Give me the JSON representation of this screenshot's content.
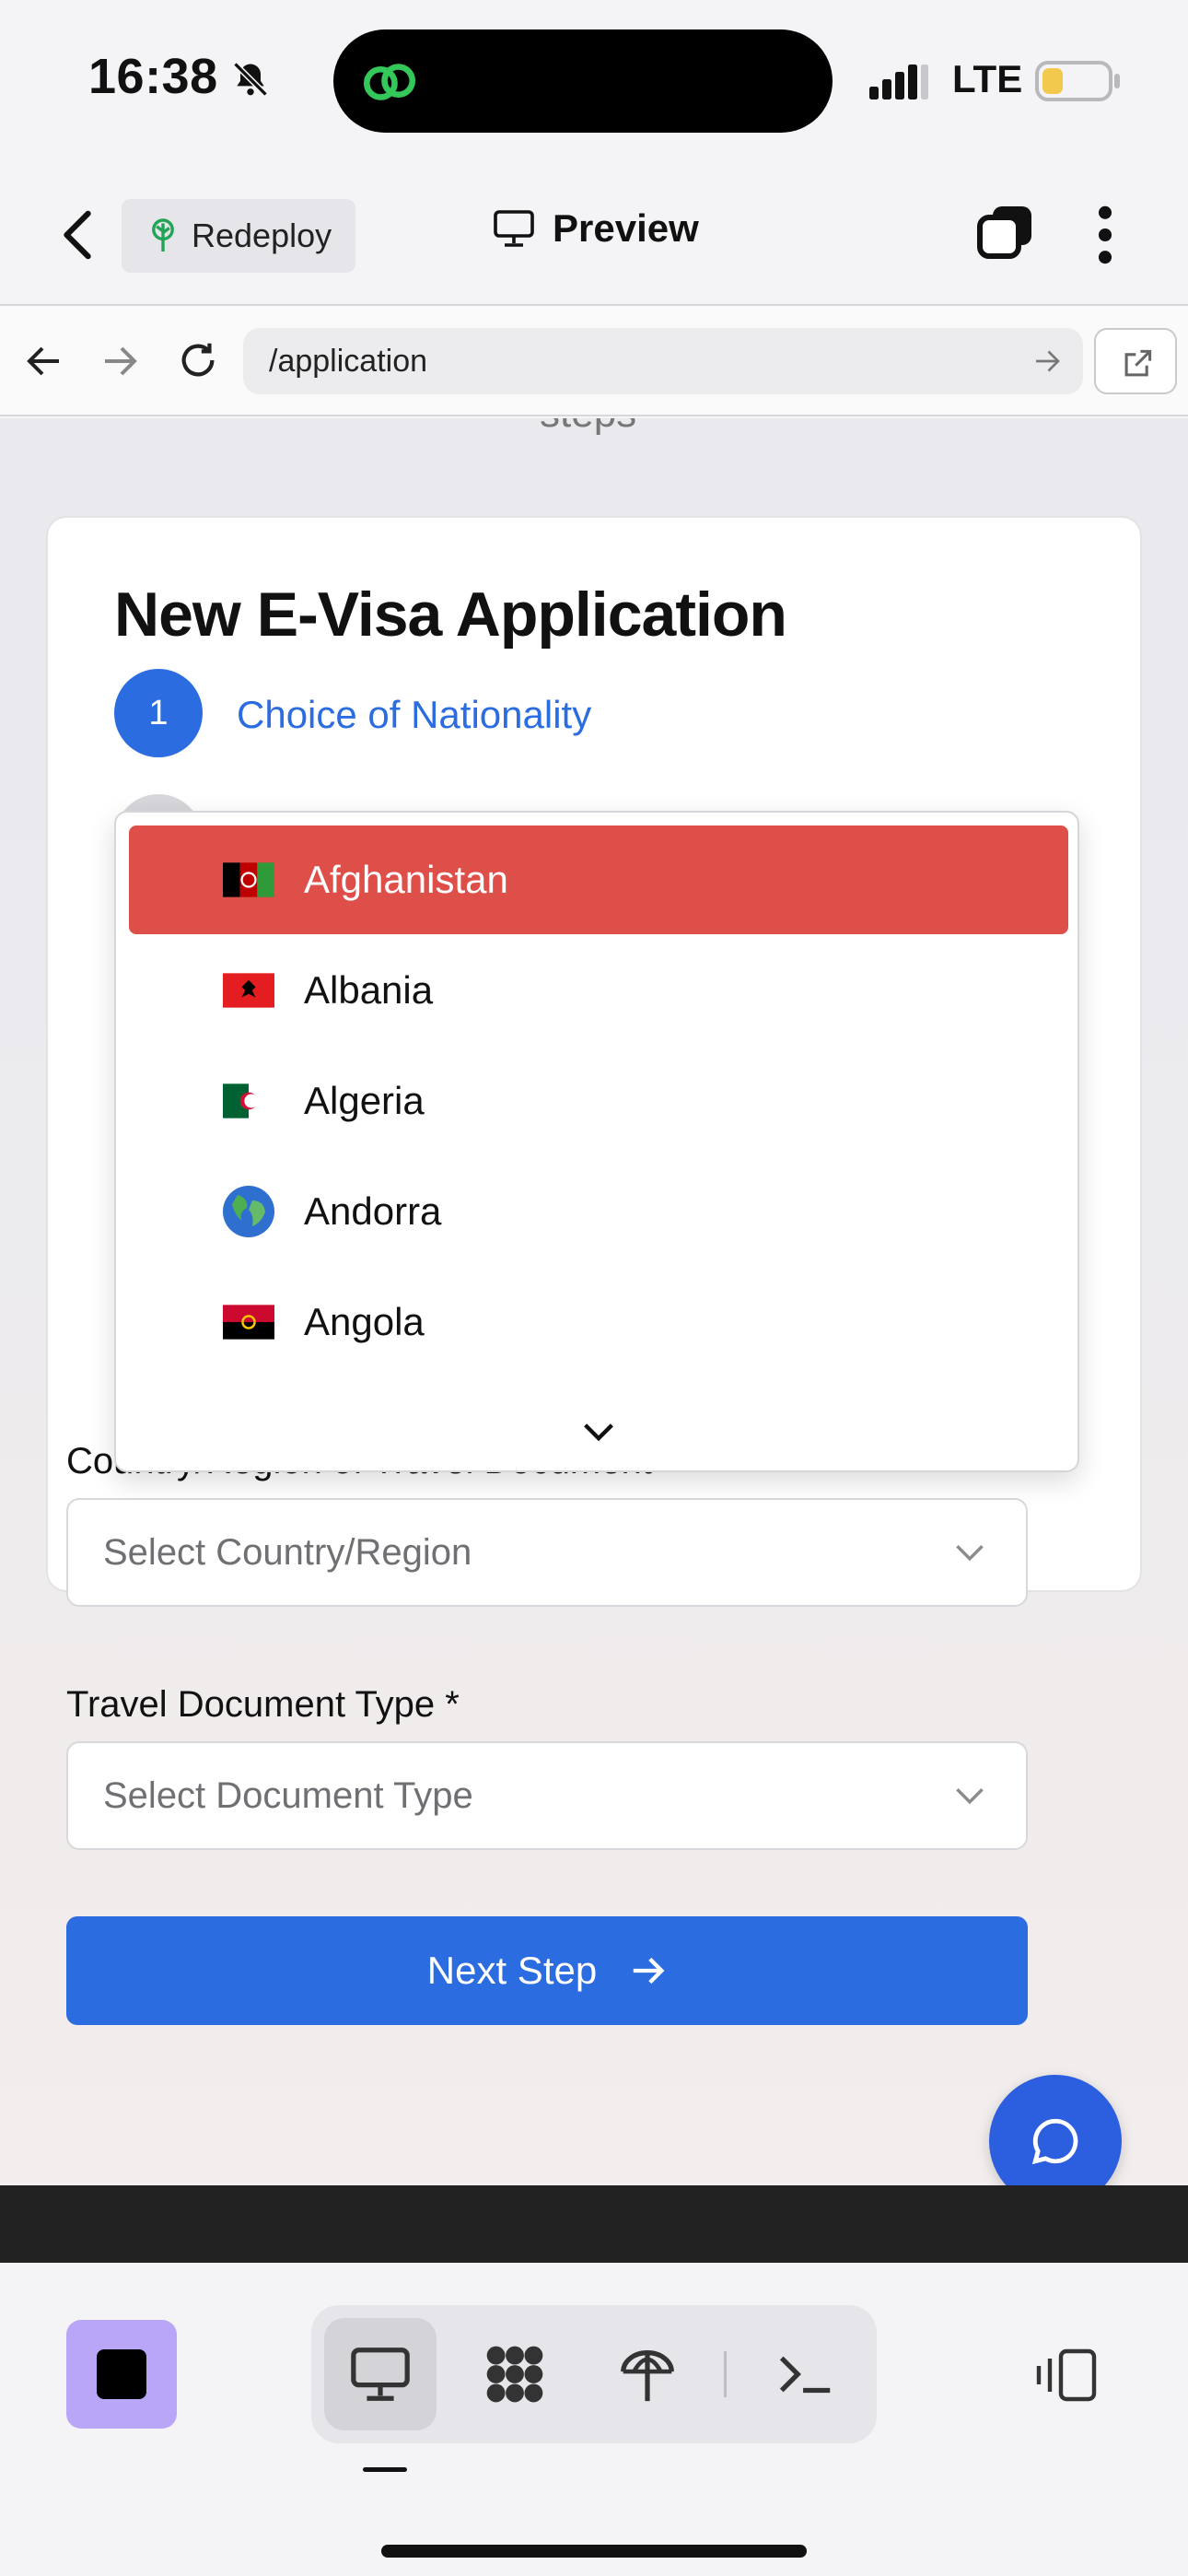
{
  "status_bar": {
    "time": "16:38",
    "network": "LTE"
  },
  "header": {
    "redeploy_label": "Redeploy",
    "preview_label": "Preview"
  },
  "browser": {
    "url": "/application"
  },
  "page": {
    "steps_partial": "steps",
    "title": "New E-Visa Application",
    "step1": {
      "number": "1",
      "label": "Choice of Nationality"
    },
    "travel_doc_country": {
      "label": "Country/Region of Travel Document",
      "placeholder": "Select Country/Region"
    },
    "travel_doc_type": {
      "label": "Travel Document Type *",
      "placeholder": "Select Document Type"
    },
    "next_button": "Next Step"
  },
  "dropdown": {
    "options": [
      {
        "label": "Afghanistan",
        "selected": true
      },
      {
        "label": "Albania",
        "selected": false
      },
      {
        "label": "Algeria",
        "selected": false
      },
      {
        "label": "Andorra",
        "selected": false
      },
      {
        "label": "Angola",
        "selected": false
      }
    ]
  },
  "colors": {
    "primary": "#2b6ce0",
    "selected_option": "#df4f4a",
    "stop_button": "#b9a6f7"
  },
  "icons": [
    "bell-slash-icon",
    "chat-icon",
    "monitor-icon",
    "grid-icon",
    "deploy-icon",
    "terminal-icon",
    "split-view-icon"
  ]
}
